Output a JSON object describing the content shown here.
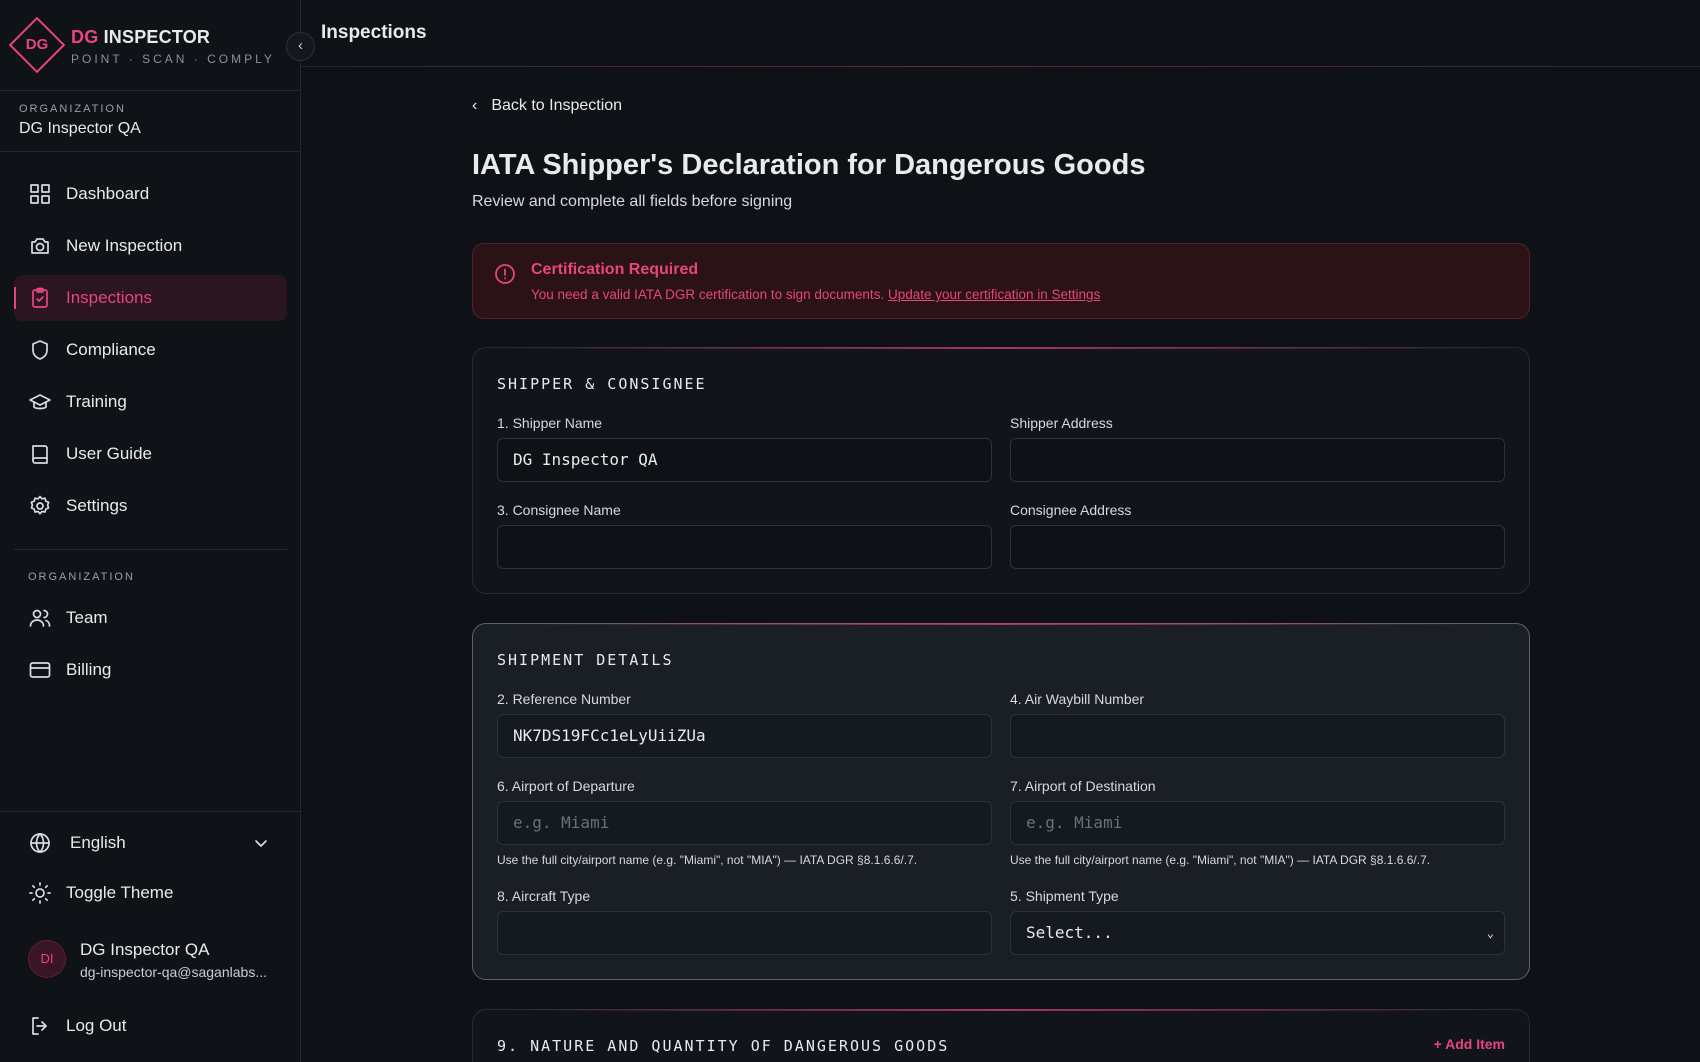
{
  "brand": {
    "mark": "DG",
    "title_accent": "DG",
    "title_rest": " INSPECTOR",
    "tagline": "POINT · SCAN · COMPLY",
    "accent_color": "#e8457d"
  },
  "sidebar": {
    "collapse_icon": "chevron-left-icon",
    "org_label": "ORGANIZATION",
    "org_name": "DG Inspector QA",
    "nav": [
      {
        "label": "Dashboard",
        "icon": "grid-icon"
      },
      {
        "label": "New Inspection",
        "icon": "camera-icon"
      },
      {
        "label": "Inspections",
        "icon": "clipboard-icon",
        "active": true
      },
      {
        "label": "Compliance",
        "icon": "shield-icon"
      },
      {
        "label": "Training",
        "icon": "graduation-cap-icon"
      },
      {
        "label": "User Guide",
        "icon": "book-icon"
      },
      {
        "label": "Settings",
        "icon": "gear-icon"
      }
    ],
    "org_section_label": "ORGANIZATION",
    "org_nav": [
      {
        "label": "Team",
        "icon": "users-icon"
      },
      {
        "label": "Billing",
        "icon": "credit-card-icon"
      }
    ],
    "language": "English",
    "toggle_theme": "Toggle Theme",
    "user": {
      "initials": "DI",
      "name": "DG Inspector QA",
      "email": "dg-inspector-qa@saganlabs..."
    },
    "logout": "Log Out"
  },
  "header": {
    "title": "Inspections"
  },
  "main": {
    "back_label": "Back to Inspection",
    "title": "IATA Shipper's Declaration for Dangerous Goods",
    "subtitle": "Review and complete all fields before signing",
    "alert": {
      "title": "Certification Required",
      "message": "You need a valid IATA DGR certification to sign documents. ",
      "link": "Update your certification in Settings"
    },
    "shipper_consignee": {
      "title": "SHIPPER & CONSIGNEE",
      "shipper_name_label": "1. Shipper Name",
      "shipper_name_value": "DG Inspector QA",
      "shipper_address_label": "Shipper Address",
      "shipper_address_value": "",
      "consignee_name_label": "3. Consignee Name",
      "consignee_name_value": "",
      "consignee_address_label": "Consignee Address",
      "consignee_address_value": ""
    },
    "shipment": {
      "title": "SHIPMENT DETAILS",
      "reference_label": "2. Reference Number",
      "reference_value": "NK7DS19FCc1eLyUiiZUa",
      "awb_label": "4. Air Waybill Number",
      "awb_value": "",
      "departure_label": "6. Airport of Departure",
      "departure_placeholder": "e.g. Miami",
      "destination_label": "7. Airport of Destination",
      "destination_placeholder": "e.g. Miami",
      "airport_hint": "Use the full city/airport name (e.g. \"Miami\", not \"MIA\") — IATA DGR §8.1.6.6/.7.",
      "aircraft_label": "8. Aircraft Type",
      "aircraft_value": "",
      "shipment_type_label": "5. Shipment Type",
      "shipment_type_value": "Select..."
    },
    "nature": {
      "title": "9. NATURE AND QUANTITY OF DANGEROUS GOODS",
      "add_item": "+ Add Item"
    }
  }
}
